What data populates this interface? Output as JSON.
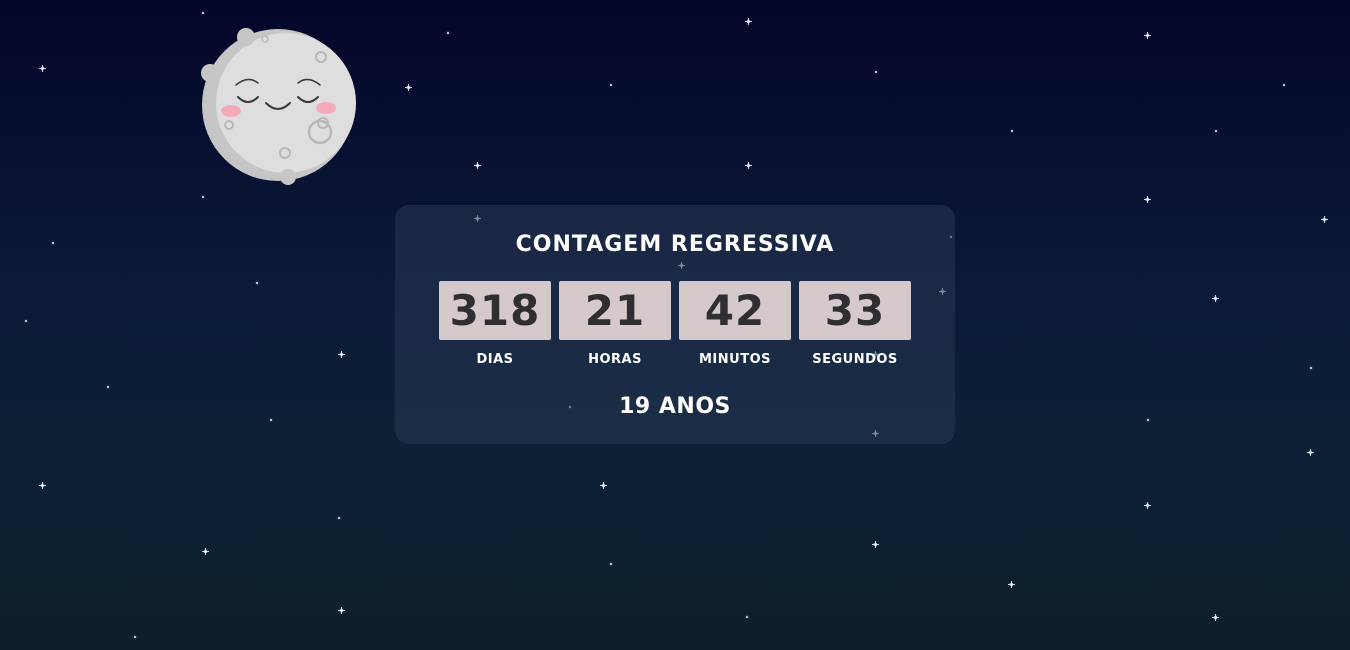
{
  "background": {
    "gradient_top": "#040629",
    "gradient_mid": "#0c2135",
    "gradient_bottom": "#0e1f2a",
    "star_color": "#e6eef8"
  },
  "moon": {
    "icon": "sleeping-moon-icon",
    "body_color": "#dcdcdc",
    "shadow_color": "#c4c4c4",
    "blush_color": "#f4aab9"
  },
  "countdown": {
    "title": "CONTAGEM REGRESSIVA",
    "units": [
      {
        "value": "318",
        "label": "DIAS"
      },
      {
        "value": "21",
        "label": "HORAS"
      },
      {
        "value": "42",
        "label": "MINUTOS"
      },
      {
        "value": "33",
        "label": "SEGUNDOS"
      }
    ],
    "age": "19 ANOS",
    "box_color": "#d6c9cc",
    "digit_color": "#2f2f33"
  }
}
